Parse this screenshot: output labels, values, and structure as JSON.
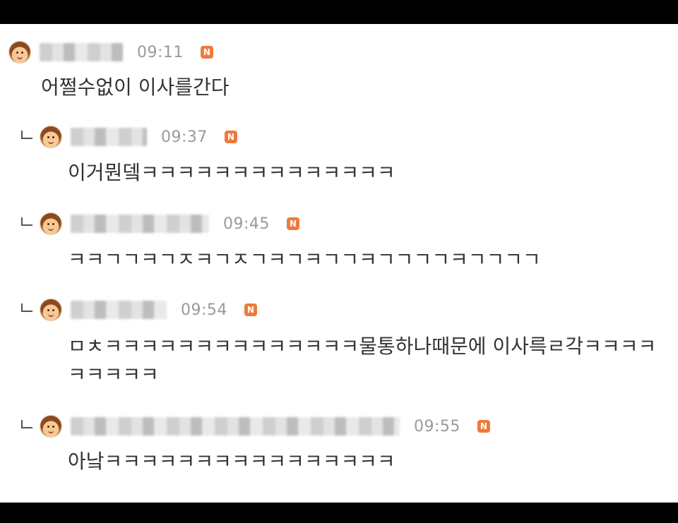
{
  "comments": [
    {
      "time": "09:11",
      "badge": "N",
      "text": "어쩔수없이 이사를간다"
    },
    {
      "time": "09:37",
      "badge": "N",
      "text": "이거뭔뎈ㅋㅋㅋㅋㅋㅋㅋㅋㅋㅋㅋㅋㅋㅋ"
    },
    {
      "time": "09:45",
      "badge": "N",
      "text": "ㅋㅋㄱㄱㅋㄱㅈㅋㄱㅈㄱㅋㄱㅋㄱㄱㅋㄱㄱㄱㄱㅋㄱㄱㄱㄱ"
    },
    {
      "time": "09:54",
      "badge": "N",
      "text": "ㅁㅊㅋㅋㅋㅋㅋㅋㅋㅋㅋㅋㅋㅋㅋㅋ물통하나때문에 이사륵ㄹ각ㅋㅋㅋㅋ",
      "text2": "ㅋㅋㅋㅋㅋ"
    },
    {
      "time": "09:55",
      "badge": "N",
      "text": "아낰ㅋㅋㅋㅋㅋㅋㅋㅋㅋㅋㅋㅋㅋㅋㅋㅋ"
    }
  ]
}
